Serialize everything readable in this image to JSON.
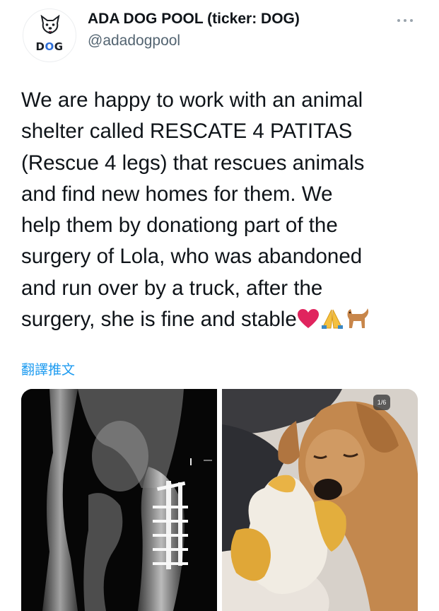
{
  "header": {
    "avatar_text_d": "D",
    "avatar_text_o": "O",
    "avatar_text_g": "G",
    "display_name": "ADA DOG POOL (ticker: DOG)",
    "handle": "@adadogpool",
    "more_icon": "more-horizontal-icon"
  },
  "tweet": {
    "text": "We are happy to work with an animal\nshelter called RESCATE 4 PATITAS\n(Rescue 4 legs) that rescues animals\nand find new homes for them. We\nhelp them by donationg part of the\nsurgery of Lola, who was abandoned\nand run over by a truck, after the\nsurgery, she is fine and stable",
    "emojis": [
      "❤️",
      "🙏",
      "🐕"
    ],
    "translate_label": "翻譯推文"
  },
  "media": {
    "counter": "1/6",
    "left_image": "xray-image",
    "right_image": "dog-with-plush-image",
    "xray_marker": "I"
  },
  "colors": {
    "link": "#1d9bf0",
    "handle": "#536471",
    "text": "#0f1419",
    "heart": "#e0245e"
  }
}
